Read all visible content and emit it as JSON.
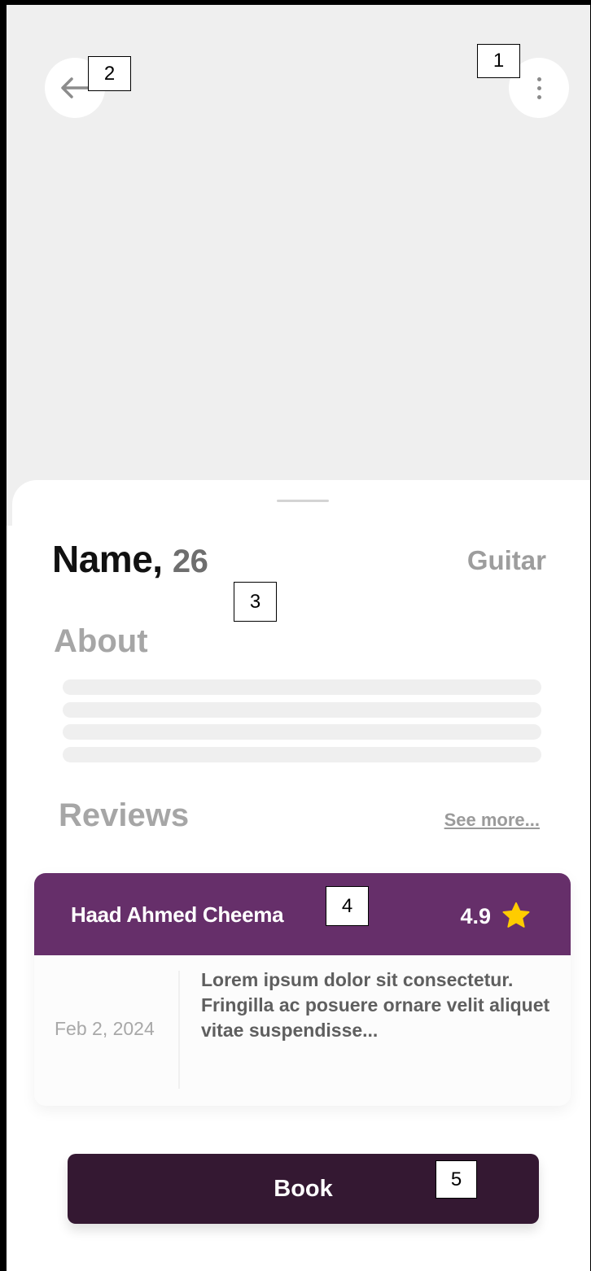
{
  "header": {
    "back_icon": "arrow-left-icon",
    "more_icon": "more-vertical-icon"
  },
  "profile": {
    "name": "Name,",
    "age": "26",
    "instrument": "Guitar"
  },
  "about": {
    "title": "About"
  },
  "reviews": {
    "title": "Reviews",
    "see_more": "See more...",
    "items": [
      {
        "reviewer": "Haad Ahmed Cheema",
        "rating": "4.9",
        "date": "Feb 2, 2024",
        "text": "Lorem ipsum dolor sit consectetur. Fringilla ac posuere ornare velit aliquet vitae suspendisse..."
      }
    ]
  },
  "actions": {
    "book_label": "Book"
  },
  "callouts": [
    "1",
    "2",
    "3",
    "4",
    "5"
  ],
  "colors": {
    "accent": "#662f6a",
    "button": "#341832",
    "star": "#ffcc00"
  }
}
